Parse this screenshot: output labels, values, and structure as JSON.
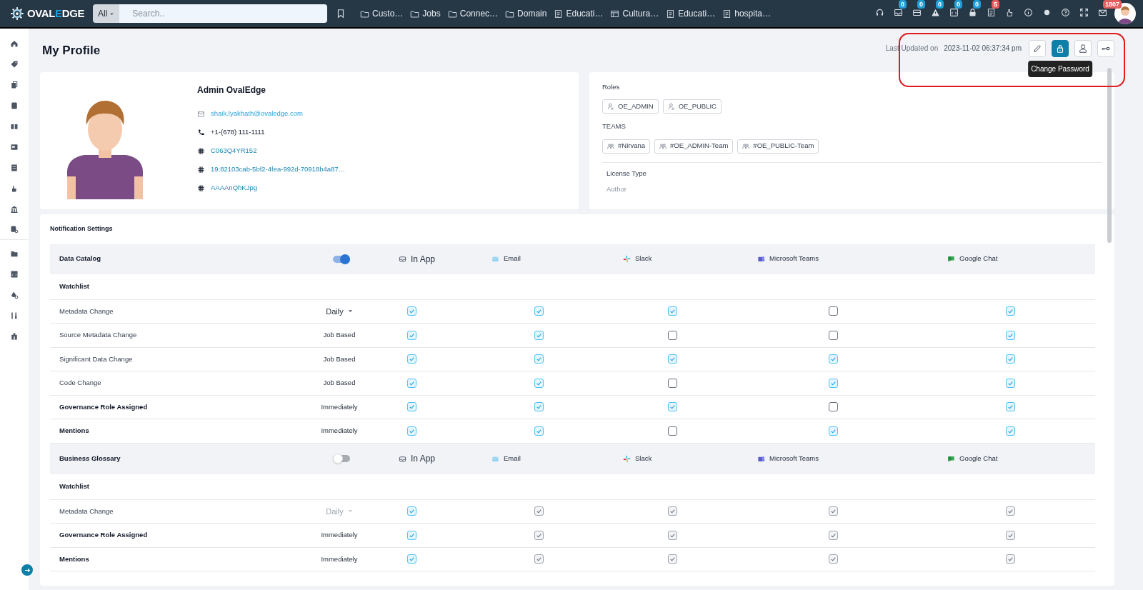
{
  "topbar": {
    "logo": {
      "prefix": "OVAL",
      "accent": "E",
      "suffix": "DGE"
    },
    "search": {
      "scope": "All",
      "placeholder": "Search.."
    },
    "shortcuts": [
      {
        "label": "Custo…",
        "kind": "folder"
      },
      {
        "label": "Jobs",
        "kind": "folder"
      },
      {
        "label": "Connec…",
        "kind": "folder"
      },
      {
        "label": "Domain",
        "kind": "folder"
      },
      {
        "label": "Educati…",
        "kind": "report"
      },
      {
        "label": "Cultura…",
        "kind": "table"
      },
      {
        "label": "Educati…",
        "kind": "report"
      },
      {
        "label": "hospita…",
        "kind": "report"
      }
    ],
    "indicators": [
      {
        "kind": "headset"
      },
      {
        "kind": "inbox",
        "badge": "0",
        "color": "#1e9fd8"
      },
      {
        "kind": "tray",
        "badge": "0",
        "color": "#1e9fd8"
      },
      {
        "kind": "alert",
        "badge": "0",
        "color": "#1e9fd8"
      },
      {
        "kind": "code",
        "badge": "0",
        "color": "#1e9fd8"
      },
      {
        "kind": "lock",
        "badge": "0",
        "color": "#1e9fd8"
      },
      {
        "kind": "report",
        "badge": "5",
        "color": "#e65b5b"
      },
      {
        "kind": "hand"
      },
      {
        "kind": "info"
      },
      {
        "kind": "dot"
      },
      {
        "kind": "help"
      },
      {
        "kind": "expand"
      },
      {
        "kind": "mail",
        "badge": "1807",
        "color": "#e65b5b"
      }
    ]
  },
  "page": {
    "title": "My Profile",
    "last_updated_label": "Last Updated on",
    "last_updated": "2023-11-02 06:37:34 pm",
    "tooltip": "Change Password",
    "actions": [
      {
        "kind": "edit",
        "selected": false
      },
      {
        "kind": "lock",
        "selected": true
      },
      {
        "kind": "user",
        "selected": false
      },
      {
        "kind": "key",
        "selected": false
      }
    ]
  },
  "profile": {
    "name": "Admin OvalEdge",
    "details": [
      {
        "kind": "email",
        "text": "shaik.lyakhath@ovaledge.com"
      },
      {
        "kind": "phone",
        "text": "+1-(678) 111-1111"
      },
      {
        "kind": "slack",
        "text": "C063Q4YR152"
      },
      {
        "kind": "slack",
        "text": "19:82103cab-5bf2-4fea-992d-70918b4a87…"
      },
      {
        "kind": "slack",
        "text": "AAAAnQhKJpg"
      }
    ]
  },
  "roles": {
    "roles_label": "Roles",
    "roles": [
      "OE_ADMIN",
      "OE_PUBLIC"
    ],
    "teams_label": "TEAMS",
    "teams": [
      "#Nirvana",
      "#OE_ADMIN-Team",
      "#OE_PUBLIC-Team"
    ],
    "license_label": "License Type",
    "license": "Author"
  },
  "notifications": {
    "title": "Notification Settings",
    "sections": [
      {
        "title": "Data Catalog",
        "on": true,
        "channels": [
          {
            "kind": "inapp",
            "label": "In App"
          },
          {
            "kind": "email",
            "label": "Email"
          },
          {
            "kind": "slack",
            "label": "Slack"
          },
          {
            "kind": "teams",
            "label": "Microsoft Teams"
          },
          {
            "kind": "gchat",
            "label": "Google Chat"
          }
        ],
        "rows": [
          {
            "kind": "heading",
            "name": "Watchlist"
          },
          {
            "kind": "setting",
            "name": "Metadata Change",
            "bold": false,
            "frequency": {
              "kind": "dropdown",
              "text": "Daily",
              "disabled": false
            },
            "checks": [
              {
                "checked": true,
                "disabled": false
              },
              {
                "checked": true,
                "disabled": false
              },
              {
                "checked": true,
                "disabled": false
              },
              {
                "checked": false,
                "disabled": false
              },
              {
                "checked": true,
                "disabled": false
              }
            ]
          },
          {
            "kind": "setting",
            "name": "Source Metadata Change",
            "bold": false,
            "frequency": {
              "kind": "text",
              "text": "Job Based"
            },
            "checks": [
              {
                "checked": true,
                "disabled": false
              },
              {
                "checked": true,
                "disabled": false
              },
              {
                "checked": false,
                "disabled": false
              },
              {
                "checked": false,
                "disabled": false
              },
              {
                "checked": true,
                "disabled": false
              }
            ]
          },
          {
            "kind": "setting",
            "name": "Significant Data Change",
            "bold": false,
            "frequency": {
              "kind": "text",
              "text": "Job Based"
            },
            "checks": [
              {
                "checked": true,
                "disabled": false
              },
              {
                "checked": true,
                "disabled": false
              },
              {
                "checked": true,
                "disabled": false
              },
              {
                "checked": true,
                "disabled": false
              },
              {
                "checked": true,
                "disabled": false
              }
            ]
          },
          {
            "kind": "setting",
            "name": "Code Change",
            "bold": false,
            "frequency": {
              "kind": "text",
              "text": "Job Based"
            },
            "checks": [
              {
                "checked": true,
                "disabled": false
              },
              {
                "checked": true,
                "disabled": false
              },
              {
                "checked": false,
                "disabled": false
              },
              {
                "checked": true,
                "disabled": false
              },
              {
                "checked": true,
                "disabled": false
              }
            ]
          },
          {
            "kind": "setting",
            "name": "Governance Role Assigned",
            "bold": true,
            "frequency": {
              "kind": "text",
              "text": "Immediately"
            },
            "checks": [
              {
                "checked": true,
                "disabled": false
              },
              {
                "checked": true,
                "disabled": false
              },
              {
                "checked": true,
                "disabled": false
              },
              {
                "checked": false,
                "disabled": false
              },
              {
                "checked": true,
                "disabled": false
              }
            ]
          },
          {
            "kind": "setting",
            "name": "Mentions",
            "bold": true,
            "frequency": {
              "kind": "text",
              "text": "Immediately"
            },
            "checks": [
              {
                "checked": true,
                "disabled": false
              },
              {
                "checked": true,
                "disabled": false
              },
              {
                "checked": false,
                "disabled": false
              },
              {
                "checked": true,
                "disabled": false
              },
              {
                "checked": true,
                "disabled": false
              }
            ]
          }
        ]
      },
      {
        "title": "Business Glossary",
        "on": false,
        "channels": [
          {
            "kind": "inapp",
            "label": "In App"
          },
          {
            "kind": "email",
            "label": "Email"
          },
          {
            "kind": "slack",
            "label": "Slack"
          },
          {
            "kind": "teams",
            "label": "Microsoft Teams"
          },
          {
            "kind": "gchat",
            "label": "Google Chat"
          }
        ],
        "rows": [
          {
            "kind": "heading",
            "name": "Watchlist"
          },
          {
            "kind": "setting",
            "name": "Metadata Change",
            "bold": false,
            "frequency": {
              "kind": "dropdown",
              "text": "Daily",
              "disabled": true
            },
            "checks": [
              {
                "checked": true,
                "disabled": false
              },
              {
                "checked": true,
                "disabled": true
              },
              {
                "checked": true,
                "disabled": true
              },
              {
                "checked": true,
                "disabled": true
              },
              {
                "checked": true,
                "disabled": true
              }
            ]
          },
          {
            "kind": "setting",
            "name": "Governance Role Assigned",
            "bold": true,
            "frequency": {
              "kind": "text",
              "text": "Immediately"
            },
            "checks": [
              {
                "checked": true,
                "disabled": false
              },
              {
                "checked": true,
                "disabled": true
              },
              {
                "checked": true,
                "disabled": true
              },
              {
                "checked": true,
                "disabled": true
              },
              {
                "checked": true,
                "disabled": true
              }
            ]
          },
          {
            "kind": "setting",
            "name": "Mentions",
            "bold": true,
            "frequency": {
              "kind": "text",
              "text": "Immediately"
            },
            "checks": [
              {
                "checked": true,
                "disabled": false
              },
              {
                "checked": true,
                "disabled": true
              },
              {
                "checked": true,
                "disabled": true
              },
              {
                "checked": true,
                "disabled": true
              },
              {
                "checked": true,
                "disabled": true
              }
            ]
          }
        ]
      }
    ]
  }
}
